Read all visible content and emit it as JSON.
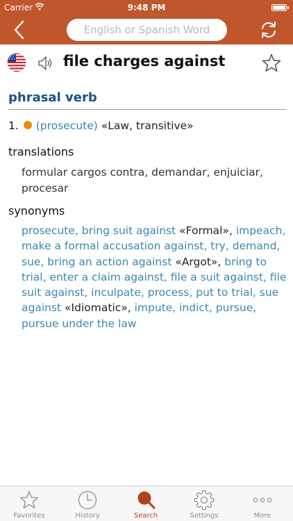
{
  "status_bar": {
    "carrier": "Carrier",
    "time": "9:48 PM",
    "battery_level": 1.0
  },
  "nav": {
    "search_placeholder": "English or Spanish Word"
  },
  "entry": {
    "headword": "file charges against",
    "part_of_speech": "phrasal verb",
    "sense": {
      "number": "1.",
      "meaning": "(prosecute)",
      "register": "«Law, transitive»"
    },
    "translations_label": "translations",
    "translations_text": "formular cargos contra, demandar, enjuiciar, procesar",
    "synonyms_label": "synonyms",
    "synonyms": [
      {
        "text": "prosecute, bring suit against",
        "type": "syn"
      },
      {
        "text": " «Formal», ",
        "type": "reg"
      },
      {
        "text": "impeach, make a formal accusation against, try, demand, sue, bring an action against",
        "type": "syn"
      },
      {
        "text": " «Argot», ",
        "type": "reg"
      },
      {
        "text": "bring to trial, enter a claim against, file a suit against, file suit against, inculpate, process, put to trial, sue against",
        "type": "syn"
      },
      {
        "text": " «Idiomatic», ",
        "type": "reg"
      },
      {
        "text": "impute, indict, pursue, pursue under the law",
        "type": "syn"
      }
    ]
  },
  "tabs": [
    {
      "label": "Favorites",
      "icon": "star-icon"
    },
    {
      "label": "History",
      "icon": "clock-icon"
    },
    {
      "label": "Search",
      "icon": "search-icon",
      "active": true
    },
    {
      "label": "Settings",
      "icon": "gear-icon"
    },
    {
      "label": "More",
      "icon": "more-icon"
    }
  ],
  "colors": {
    "brand": "#c0562c",
    "link_blue": "#3a86b6",
    "pos_blue": "#1d4f8a",
    "dot_orange": "#f0860f",
    "tab_active": "#b3431f"
  }
}
